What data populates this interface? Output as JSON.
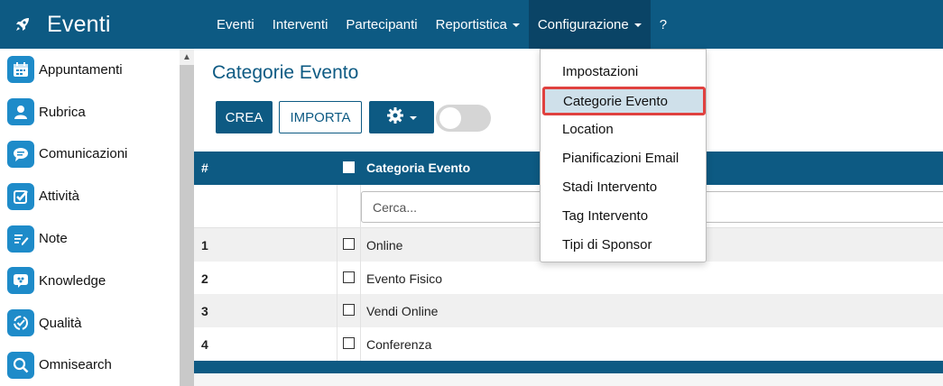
{
  "app": {
    "title": "Eventi",
    "logo_icon": "rocket-icon"
  },
  "nav": {
    "items": [
      {
        "label": "Eventi"
      },
      {
        "label": "Interventi"
      },
      {
        "label": "Partecipanti"
      },
      {
        "label": "Reportistica",
        "has_caret": true
      },
      {
        "label": "Configurazione",
        "has_caret": true,
        "active": true
      },
      {
        "label": "?"
      }
    ]
  },
  "sidebar": {
    "items": [
      {
        "label": "Appuntamenti",
        "icon": "calendar-icon"
      },
      {
        "label": "Rubrica",
        "icon": "contacts-icon"
      },
      {
        "label": "Comunicazioni",
        "icon": "chat-icon"
      },
      {
        "label": "Attività",
        "icon": "checkbox-icon"
      },
      {
        "label": "Note",
        "icon": "note-icon"
      },
      {
        "label": "Knowledge",
        "icon": "brain-icon"
      },
      {
        "label": "Qualità",
        "icon": "quality-icon"
      },
      {
        "label": "Omnisearch",
        "icon": "search-icon"
      }
    ]
  },
  "main": {
    "title": "Categorie Evento",
    "buttons": {
      "create": "CREA",
      "import": "IMPORTA"
    },
    "table": {
      "headers": {
        "number": "#",
        "category": "Categoria Evento"
      },
      "search_placeholder": "Cerca...",
      "rows": [
        {
          "num": "1",
          "category": "Online"
        },
        {
          "num": "2",
          "category": "Evento Fisico"
        },
        {
          "num": "3",
          "category": "Vendi Online"
        },
        {
          "num": "4",
          "category": "Conferenza"
        }
      ]
    }
  },
  "dropdown": {
    "items": [
      {
        "label": "Impostazioni"
      },
      {
        "label": "Categorie Evento",
        "highlighted": true
      },
      {
        "label": "Location"
      },
      {
        "label": "Pianificazioni Email"
      },
      {
        "label": "Stadi Intervento"
      },
      {
        "label": "Tag Intervento"
      },
      {
        "label": "Tipi di Sponsor"
      }
    ]
  },
  "colors": {
    "primary": "#0d5a83",
    "highlight_border": "#e0413f",
    "highlight_bg": "#cfe0ea",
    "sidebar_icon": "#1e8bc9"
  }
}
